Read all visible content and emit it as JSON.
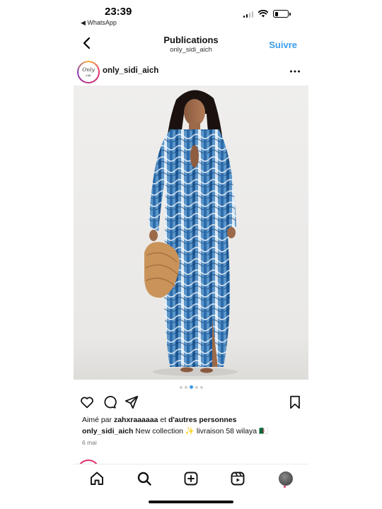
{
  "status_bar": {
    "time": "23:39",
    "back_app": "◀ WhatsApp",
    "icons": [
      "signal-icon",
      "wifi-icon",
      "battery-icon"
    ],
    "signal_bars_active": 2,
    "battery_level": 0.25
  },
  "header": {
    "title": "Publications",
    "subtitle": "only_sidi_aich",
    "follow_label": "Suivre",
    "back_icon": "chevron-left-icon"
  },
  "post": {
    "username": "only_sidi_aich",
    "avatar_text": "Only",
    "avatar_subtext": "sidi",
    "more_icon": "more-horizontal-icon",
    "image_alt": "model wearing a long blue and white wave-pattern dress holding a straw bag",
    "carousel": {
      "count": 5,
      "active_index": 2
    },
    "actions": [
      "heart-icon",
      "comment-icon",
      "share-icon",
      "bookmark-icon"
    ],
    "likes_prefix": "Aimé par",
    "likes_user": "zahxraaaaaa",
    "likes_middle": "et",
    "likes_others": "d'autres personnes",
    "caption_user": "only_sidi_aich",
    "caption_text": "New collection ✨ livraison 58 wilaya 🇩🇿",
    "date": "6 mai"
  },
  "tabbar": {
    "items": [
      "home-icon",
      "search-icon",
      "create-icon",
      "reels-icon",
      "profile-avatar"
    ]
  },
  "colors": {
    "accent": "#3d9be8",
    "text": "#111111",
    "muted": "#777777",
    "dress_dark": "#1f5a96",
    "dress_mid": "#5b95c9",
    "dress_light": "#dbe9f5"
  }
}
